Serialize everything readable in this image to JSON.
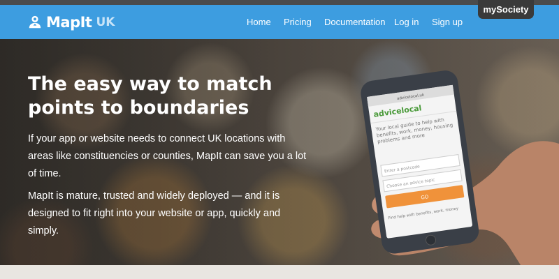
{
  "brand": {
    "name": "MapIt",
    "region": "UK",
    "partner": "mySociety"
  },
  "nav": {
    "items": [
      {
        "label": "Home"
      },
      {
        "label": "Pricing"
      },
      {
        "label": "Documentation"
      },
      {
        "label": "Log in"
      },
      {
        "label": "Sign up"
      }
    ]
  },
  "hero": {
    "title_line1": "The easy way to match",
    "title_line2": "points to boundaries",
    "paragraph1": "If your app or website needs to connect UK locations with areas like constituencies or counties, MapIt can save you a lot of time.",
    "paragraph2": "MapIt is mature, trusted and widely deployed — and it is designed to fit right into your website or app, quickly and simply."
  },
  "phone_screen": {
    "address_bar": "advicelocal.uk",
    "app_name": "advicelocal",
    "tagline": "Your local guide to help with benefits, work, money, housing problems and more",
    "postcode_placeholder": "Enter a postcode",
    "topic_placeholder": "Choose an advice topic",
    "button_label": "GO",
    "footer_text": "Find help with benefits, work, money"
  },
  "colors": {
    "header": "#3d9de0",
    "top_strip": "#4b4b4b",
    "partner_badge": "#3a3a3a",
    "go_button": "#f0923a",
    "page_bottom": "#e9e6e1"
  }
}
